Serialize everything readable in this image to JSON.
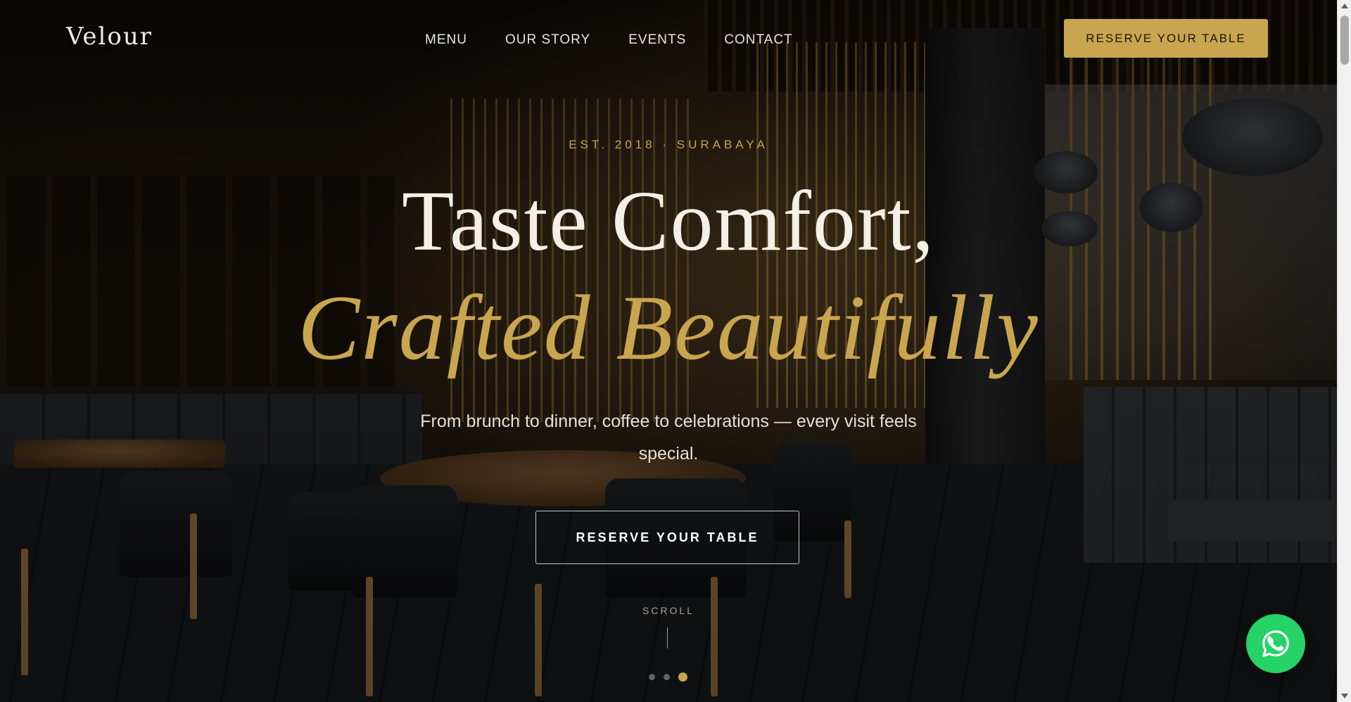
{
  "brand": {
    "logo": "Velour"
  },
  "nav": {
    "items": [
      {
        "label": "MENU"
      },
      {
        "label": "OUR STORY"
      },
      {
        "label": "EVENTS"
      },
      {
        "label": "CONTACT"
      }
    ],
    "cta_label": "RESERVE YOUR TABLE"
  },
  "hero": {
    "eyebrow": "EST. 2018 · SURABAYA",
    "headline_line1": "Taste Comfort,",
    "headline_line2": "Crafted Beautifully",
    "subtitle": "From brunch to dinner, coffee to celebrations — every visit feels special.",
    "cta_label": "RESERVE YOUR TABLE",
    "scroll_label": "SCROLL",
    "slides": {
      "count": 3,
      "active_index": 2
    }
  },
  "floating": {
    "whatsapp_icon": "whatsapp-icon"
  },
  "colors": {
    "accent_gold": "#c9a54f",
    "whatsapp_green": "#25d366",
    "headline_white": "#f5efe6"
  }
}
